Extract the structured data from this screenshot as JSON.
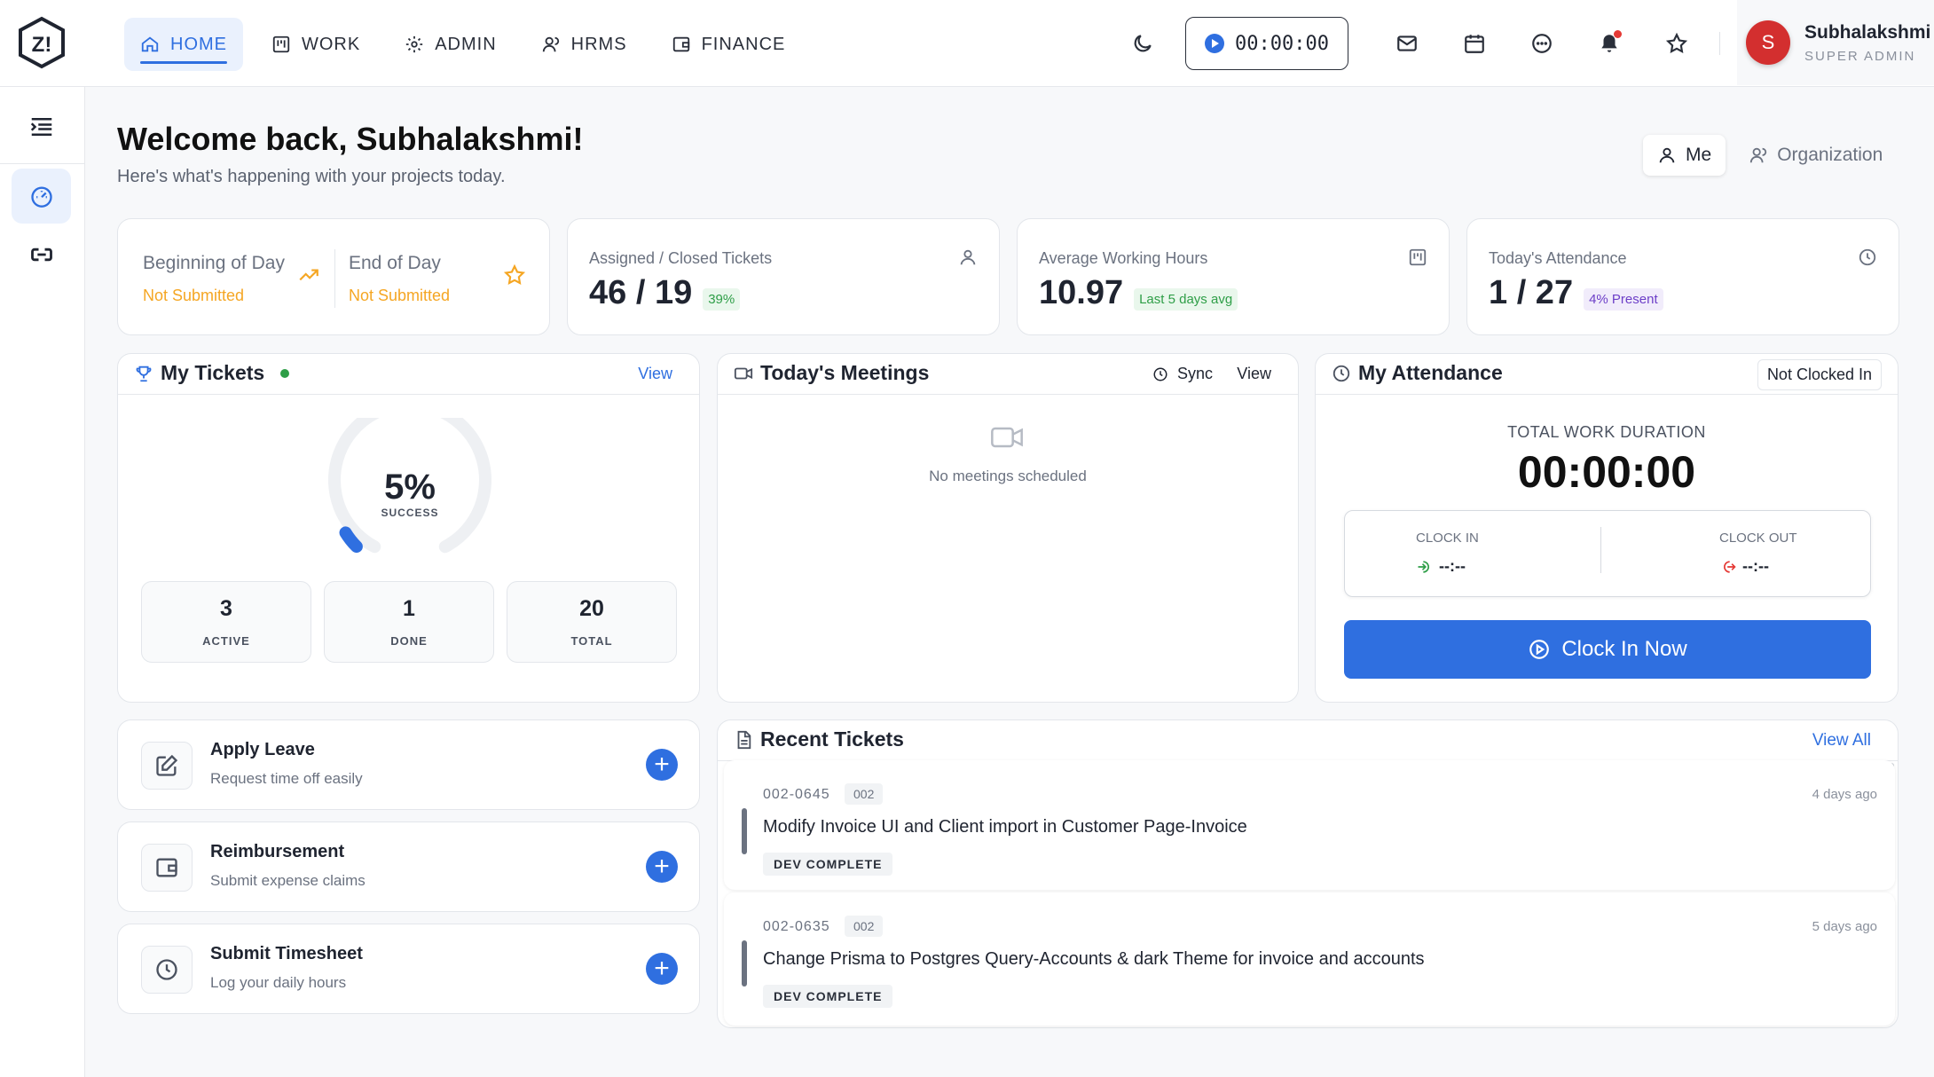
{
  "nav": {
    "items": [
      {
        "label": "HOME",
        "icon": "home-icon",
        "active": true
      },
      {
        "label": "WORK",
        "icon": "kanban-icon"
      },
      {
        "label": "ADMIN",
        "icon": "gear-icon"
      },
      {
        "label": "HRMS",
        "icon": "users-icon"
      },
      {
        "label": "FINANCE",
        "icon": "wallet-icon"
      }
    ]
  },
  "toolbar": {
    "timer": "00:00:00"
  },
  "user": {
    "initial": "S",
    "name": "Subhalakshmi",
    "role": "SUPER ADMIN"
  },
  "header": {
    "welcome": "Welcome back, Subhalakshmi!",
    "subtitle": "Here's what's happening with your projects today.",
    "toggle": {
      "me": "Me",
      "org": "Organization"
    }
  },
  "stats": {
    "day": {
      "bod_label": "Beginning of Day",
      "bod_status": "Not Submitted",
      "eod_label": "End of Day",
      "eod_status": "Not Submitted"
    },
    "tickets": {
      "title": "Assigned / Closed Tickets",
      "value": "46 / 19",
      "pill": "39%"
    },
    "hours": {
      "title": "Average Working Hours",
      "value": "10.97",
      "pill": "Last 5 days avg"
    },
    "attendance": {
      "title": "Today's Attendance",
      "value": "1 / 27",
      "pill": "4% Present"
    }
  },
  "my_tickets": {
    "title": "My Tickets",
    "view": "View",
    "percent": "5%",
    "percent_label": "SUCCESS",
    "progress": 0.05,
    "active": "3",
    "active_label": "ACTIVE",
    "done": "1",
    "done_label": "DONE",
    "total": "20",
    "total_label": "TOTAL"
  },
  "meetings": {
    "title": "Today's Meetings",
    "sync": "Sync",
    "view": "View",
    "empty": "No meetings scheduled"
  },
  "attendance": {
    "title": "My Attendance",
    "badge": "Not Clocked In",
    "duration_label": "TOTAL WORK DURATION",
    "duration": "00:00:00",
    "clock_in_label": "CLOCK IN",
    "clock_in_value": "--:--",
    "clock_out_label": "CLOCK OUT",
    "clock_out_value": "--:--",
    "button": "Clock In Now"
  },
  "actions": [
    {
      "title": "Apply Leave",
      "subtitle": "Request time off easily"
    },
    {
      "title": "Reimbursement",
      "subtitle": "Submit expense claims"
    },
    {
      "title": "Submit Timesheet",
      "subtitle": "Log your daily hours"
    }
  ],
  "recent": {
    "title": "Recent Tickets",
    "view_all": "View All",
    "tickets": [
      {
        "id": "002-0645",
        "project": "002",
        "ago": "4 days ago",
        "title": "Modify Invoice UI and Client import in Customer Page-Invoice",
        "status": "DEV COMPLETE"
      },
      {
        "id": "002-0635",
        "project": "002",
        "ago": "5 days ago",
        "title": "Change Prisma to Postgres Query-Accounts & dark Theme for invoice and accounts",
        "status": "DEV COMPLETE"
      }
    ]
  },
  "colors": {
    "primary": "#2f6fe0",
    "warning": "#f5a623",
    "success": "#2e9e47",
    "danger": "#e53935"
  }
}
